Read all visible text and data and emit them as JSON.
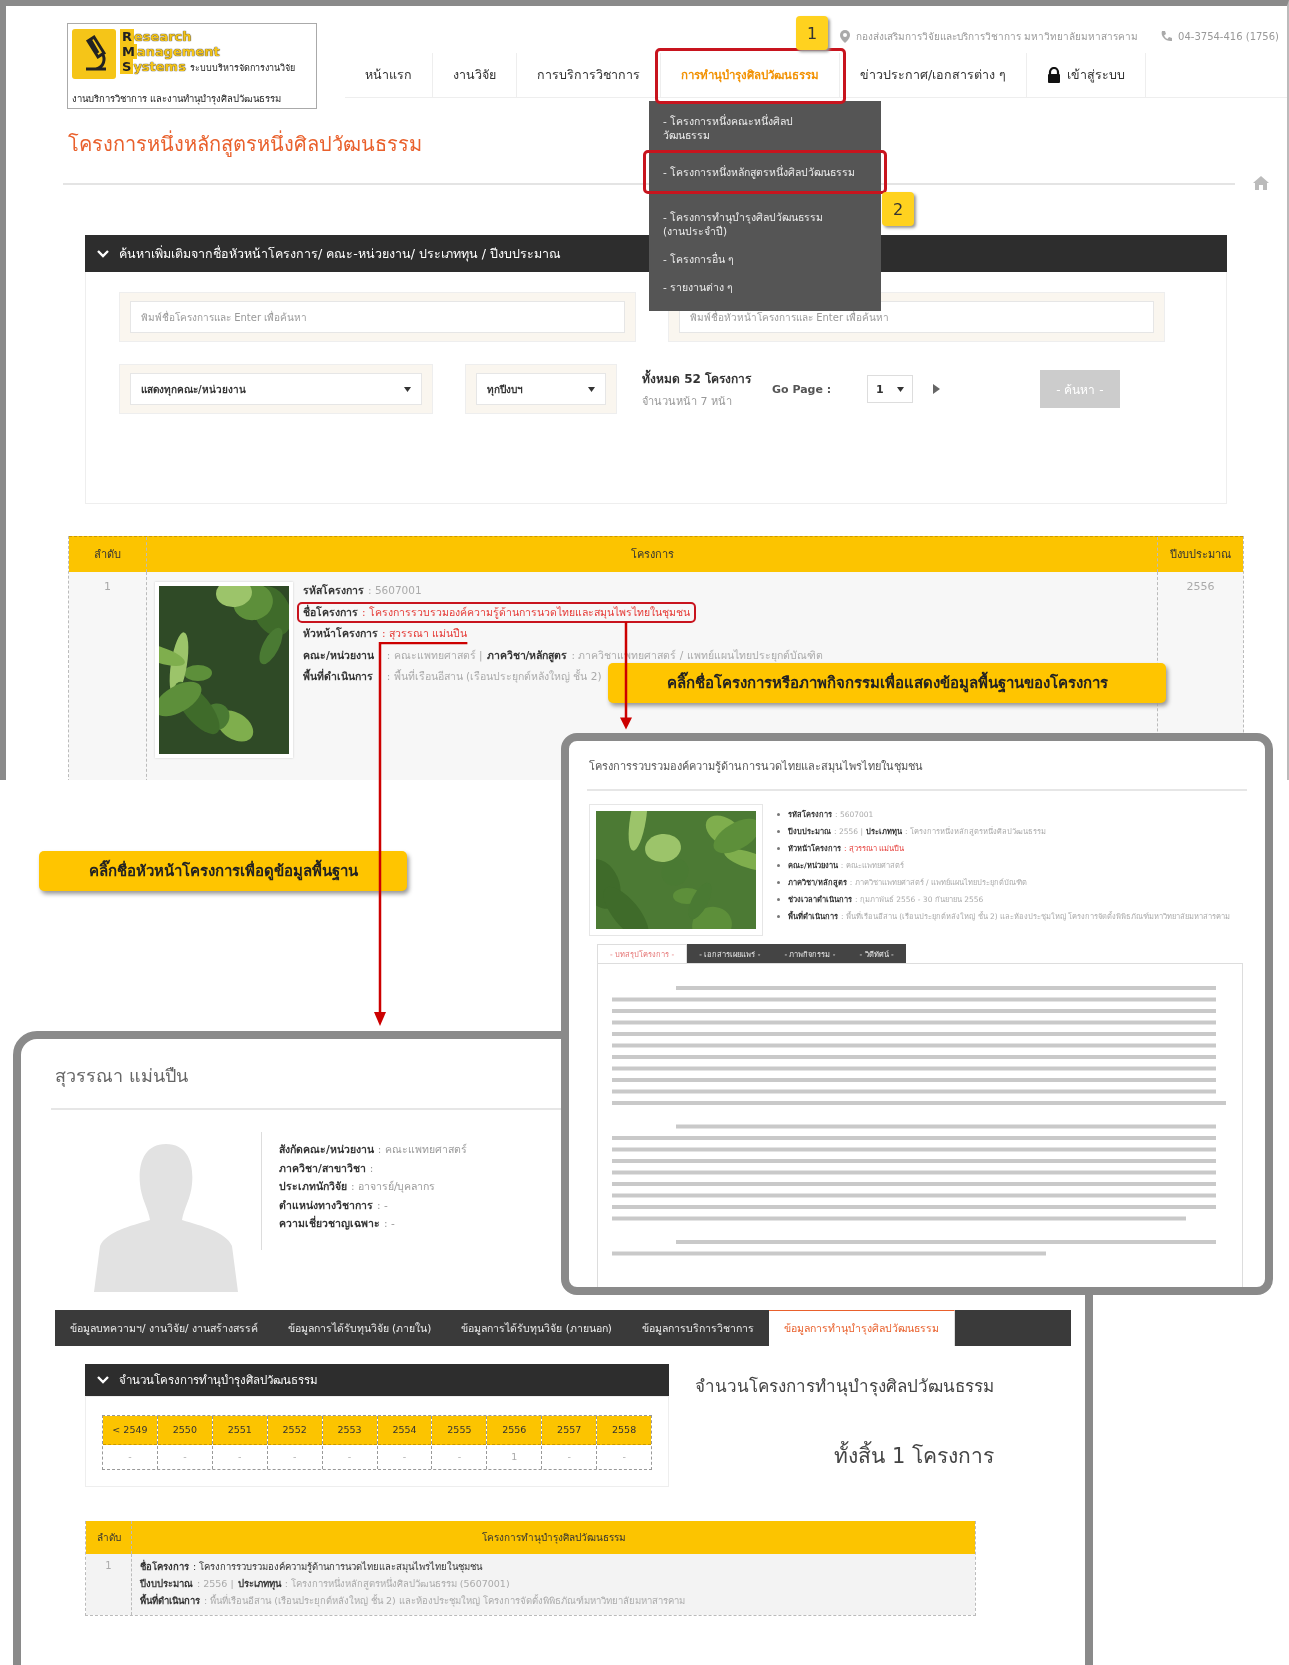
{
  "site_header": {
    "logo": {
      "lines": [
        {
          "initial": "R",
          "rest": "esearch"
        },
        {
          "initial": "M",
          "rest": "anagement"
        },
        {
          "initial": "S",
          "rest": "ystems",
          "suffix": "ระบบบริหารจัดการงานวิจัย"
        }
      ],
      "tagline": "งานบริการวิชาการ และงานทำนุบำรุงศิลปวัฒนธรรม"
    },
    "location": "กองส่งเสริมการวิจัยและบริการวิชาการ มหาวิทยาลัยมหาสารคาม",
    "phone": "04-3754-416 (1756)",
    "nav": [
      {
        "label": "หน้าแรก",
        "selected": false,
        "kind": "text"
      },
      {
        "label": "งานวิจัย",
        "selected": false,
        "kind": "text"
      },
      {
        "label": "การบริการวิชาการ",
        "selected": false,
        "kind": "text"
      },
      {
        "label": "การทำนุบำรุงศิลปวัฒนธรรม",
        "selected": true,
        "kind": "text"
      },
      {
        "label": "ข่าวประกาศ/เอกสารต่าง ๆ",
        "selected": false,
        "kind": "text"
      },
      {
        "label": "เข้าสู่ระบบ",
        "selected": false,
        "kind": "lock"
      }
    ],
    "dropdown": [
      "- โครงการหนึ่งคณะหนึ่งศิลปวัฒนธรรม",
      "- โครงการหนึ่งหลักสูตรหนึ่งศิลปวัฒนธรรม",
      "- โครงการทำนุบำรุงศิลปวัฒนธรรม (งานประจำปี)",
      "- โครงการอื่น ๆ",
      "- รายงานต่าง ๆ"
    ]
  },
  "step_markers": [
    "1",
    "2"
  ],
  "page_title": "โครงการหนึ่งหลักสูตรหนึ่งศิลปวัฒนธรรม",
  "search_panel": {
    "heading": "ค้นหาเพิ่มเติมจากชื่อหัวหน้าโครงการ/ คณะ-หน่วยงาน/ ประเภททุน / ปีงบประมาณ",
    "fields": [
      {
        "placeholder": "พิมพ์ชื่อโครงการและ Enter เพื่อค้นหา"
      },
      {
        "placeholder": "พิมพ์ชื่อหัวหน้าโครงการและ Enter เพื่อค้นหา"
      }
    ],
    "selects": [
      {
        "value": "แสดงทุกคณะ/หน่วยงาน"
      },
      {
        "value": "ทุกปีงบฯ"
      }
    ],
    "total": "ทั้งหมด 52 โครงการ",
    "pages": "จำนวนหน้า 7 หน้า",
    "go_page_label": "Go Page :",
    "page_select": "1",
    "search_button": "- ค้นหา -"
  },
  "results_table": {
    "columns": [
      "ลำดับ",
      "โครงการ",
      "ปีงบประมาณ"
    ],
    "rows": [
      {
        "index": "1",
        "year": "2556",
        "lines": [
          [
            {
              "kind": "label",
              "text": "รหัสโครงการ"
            },
            {
              "kind": "value",
              "text": ": 5607001"
            }
          ],
          [
            {
              "kind": "label",
              "text": "ชื่อโครงการ"
            },
            {
              "kind": "link",
              "text": ": โครงการรวบรวมองค์ความรู้ด้านการนวดไทยและสมุนไพรไทยในชุมชน"
            }
          ],
          [
            {
              "kind": "label",
              "text": "หัวหน้าโครงการ"
            },
            {
              "kind": "link",
              "text": ": สุวรรณา แม่นปืน"
            }
          ],
          [
            {
              "kind": "label",
              "text": "คณะ/หน่วยงาน"
            },
            {
              "kind": "value",
              "text": ": คณะแพทยศาสตร์ |"
            },
            {
              "kind": "label",
              "text": "ภาควิชา/หลักสูตร"
            },
            {
              "kind": "value",
              "text": ": ภาควิชาแพทยศาสตร์ / แพทย์แผนไทยประยุกต์บัณฑิต"
            }
          ],
          [
            {
              "kind": "label",
              "text": "พื้นที่ดำเนินการ"
            },
            {
              "kind": "value",
              "text": ": พื้นที่เรือนอีสาน (เรือนประยุกต์หลังใหญ่ ชั้น 2)"
            }
          ]
        ]
      }
    ]
  },
  "callouts": [
    "คลิ๊กชื่อโครงการหรือภาพกิจกรรมเพื่อแสดงข้อมูลพื้นฐานของโครงการ",
    "คลิ๊กชื่อหัวหน้าโครงการเพื่อดูข้อมูลพื้นฐาน"
  ],
  "project_popup": {
    "title": "โครงการรวบรวมองค์ความรู้ด้านการนวดไทยและสมุนไพรไทยในชุมชน",
    "details": [
      [
        {
          "kind": "label",
          "text": "รหัสโครงการ"
        },
        {
          "kind": "value",
          "text": ": 5607001"
        }
      ],
      [
        {
          "kind": "label",
          "text": "ปีงบประมาณ"
        },
        {
          "kind": "value",
          "text": ": 2556 |"
        },
        {
          "kind": "label",
          "text": "ประเภททุน"
        },
        {
          "kind": "value",
          "text": ": โครงการหนึ่งหลักสูตรหนึ่งศิลปวัฒนธรรม"
        }
      ],
      [
        {
          "kind": "label",
          "text": "หัวหน้าโครงการ"
        },
        {
          "kind": "link",
          "text": ": สุวรรณา แม่นปืน"
        }
      ],
      [
        {
          "kind": "label",
          "text": "คณะ/หน่วยงาน"
        },
        {
          "kind": "value",
          "text": ": คณะแพทยศาสตร์"
        }
      ],
      [
        {
          "kind": "label",
          "text": "ภาควิชา/หลักสูตร"
        },
        {
          "kind": "value",
          "text": ": ภาควิชาแพทยศาสตร์ / แพทย์แผนไทยประยุกต์บัณฑิต"
        }
      ],
      [
        {
          "kind": "label",
          "text": "ช่วงเวลาดำเนินการ"
        },
        {
          "kind": "value",
          "text": ": กุมภาพันธ์ 2556 - 30 กันยายน 2556"
        }
      ],
      [
        {
          "kind": "label",
          "text": "พื้นที่ดำเนินการ"
        },
        {
          "kind": "value",
          "text": ": พื้นที่เรือนอีสาน (เรือนประยุกต์หลังใหญ่ ชั้น 2) และห้องประชุมใหญ่ โครงการจัดตั้งพิพิธภัณฑ์มหาวิทยาลัยมหาสารคาม"
        }
      ]
    ],
    "tabs": [
      {
        "label": "- บทสรุปโครงการ -",
        "selected": true
      },
      {
        "label": "- เอกสารเผยแพร่ -",
        "selected": false
      },
      {
        "label": "- ภาพกิจกรรม -",
        "selected": false
      },
      {
        "label": "- วิดีทัศน์ -",
        "selected": false
      }
    ]
  },
  "researcher_profile": {
    "name": "สุวรรณา แม่นปืน",
    "info": [
      {
        "label": "สังกัดคณะ/หน่วยงาน",
        "value": ": คณะแพทยศาสตร์"
      },
      {
        "label": "ภาควิชา/สาขาวิชา",
        "value": ":"
      },
      {
        "label": "ประเภทนักวิจัย",
        "value": ": อาจารย์/บุคลากร"
      },
      {
        "label": "ตำแหน่งทางวิชาการ",
        "value": ": -"
      },
      {
        "label": "ความเชี่ยวชาญเฉพาะ",
        "value": ": -"
      }
    ],
    "tabs": [
      {
        "label": "ข้อมูลบทความฯ/ งานวิจัย/ งานสร้างสรรค์",
        "selected": false
      },
      {
        "label": "ข้อมูลการได้รับทุนวิจัย (ภายใน)",
        "selected": false
      },
      {
        "label": "ข้อมูลการได้รับทุนวิจัย (ภายนอก)",
        "selected": false
      },
      {
        "label": "ข้อมูลการบริการวิชาการ",
        "selected": false
      },
      {
        "label": "ข้อมูลการทำนุบำรุงศิลปวัฒนธรรม",
        "selected": true
      }
    ],
    "stats_heading": "จำนวนโครงการทำนุบำรุงศิลปวัฒนธรรม",
    "years": [
      {
        "year": "< 2549",
        "count": "-"
      },
      {
        "year": "2550",
        "count": "-"
      },
      {
        "year": "2551",
        "count": "-"
      },
      {
        "year": "2552",
        "count": "-"
      },
      {
        "year": "2553",
        "count": "-"
      },
      {
        "year": "2554",
        "count": "-"
      },
      {
        "year": "2555",
        "count": "-"
      },
      {
        "year": "2556",
        "count": "1"
      },
      {
        "year": "2557",
        "count": "-"
      },
      {
        "year": "2558",
        "count": "-"
      }
    ],
    "summary_title": "จำนวนโครงการทำนุบำรุงศิลปวัฒนธรรม",
    "summary_total": "ทั้งสิ้น 1 โครงการ",
    "projects_table": {
      "columns": [
        "ลำดับ",
        "โครงการทำนุบำรุงศิลปวัฒนธรรม"
      ],
      "rows": [
        {
          "index": "1",
          "lines": [
            [
              {
                "kind": "label",
                "text": "ชื่อโครงการ"
              },
              {
                "kind": "strong",
                "text": ": โครงการรวบรวมองค์ความรู้ด้านการนวดไทยและสมุนไพรไทยในชุมชน"
              }
            ],
            [
              {
                "kind": "label",
                "text": "ปีงบประมาณ"
              },
              {
                "kind": "value",
                "text": ": 2556 |"
              },
              {
                "kind": "label",
                "text": "ประเภททุน"
              },
              {
                "kind": "value",
                "text": ": โครงการหนึ่งหลักสูตรหนึ่งศิลปวัฒนธรรม (5607001)"
              }
            ],
            [
              {
                "kind": "label",
                "text": "พื้นที่ดำเนินการ"
              },
              {
                "kind": "value",
                "text": ": พื้นที่เรือนอีสาน (เรือนประยุกต์หลังใหญ่ ชั้น 2) และห้องประชุมใหญ่ โครงการจัดตั้งพิพิธภัณฑ์มหาวิทยาลัยมหาสารคาม"
              }
            ]
          ]
        }
      ]
    }
  }
}
